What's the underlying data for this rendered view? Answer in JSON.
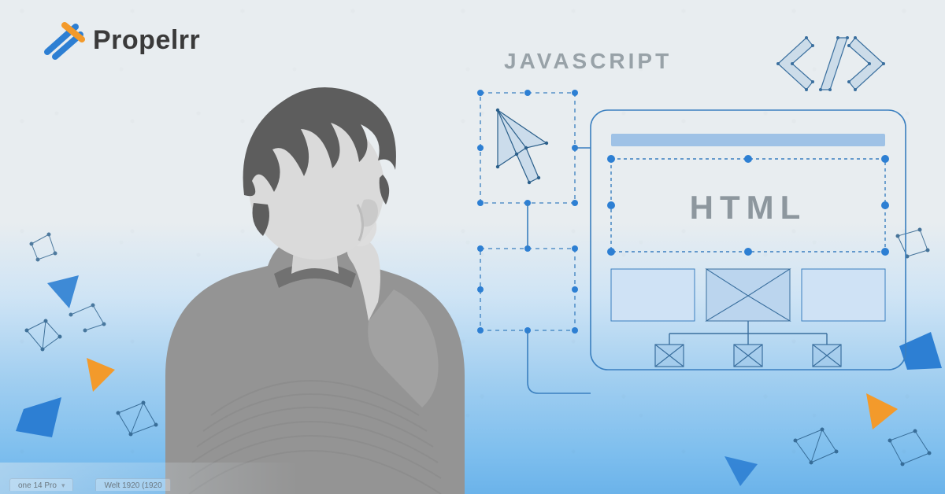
{
  "brand": {
    "name": "Propelrr"
  },
  "labels": {
    "javascript": "JAVASCRIPT",
    "html": "HTML"
  },
  "colors": {
    "accent_blue": "#2d7fd3",
    "accent_orange": "#f39a2b",
    "line_blue": "#3a7fbf",
    "text_gray": "#8d979e"
  },
  "bottom_bar": {
    "device_label": "one 14 Pro",
    "viewport_label": "Welt 1920 (1920"
  },
  "icons": {
    "code_brackets": "code-brackets-icon",
    "cursor": "cursor-icon"
  }
}
